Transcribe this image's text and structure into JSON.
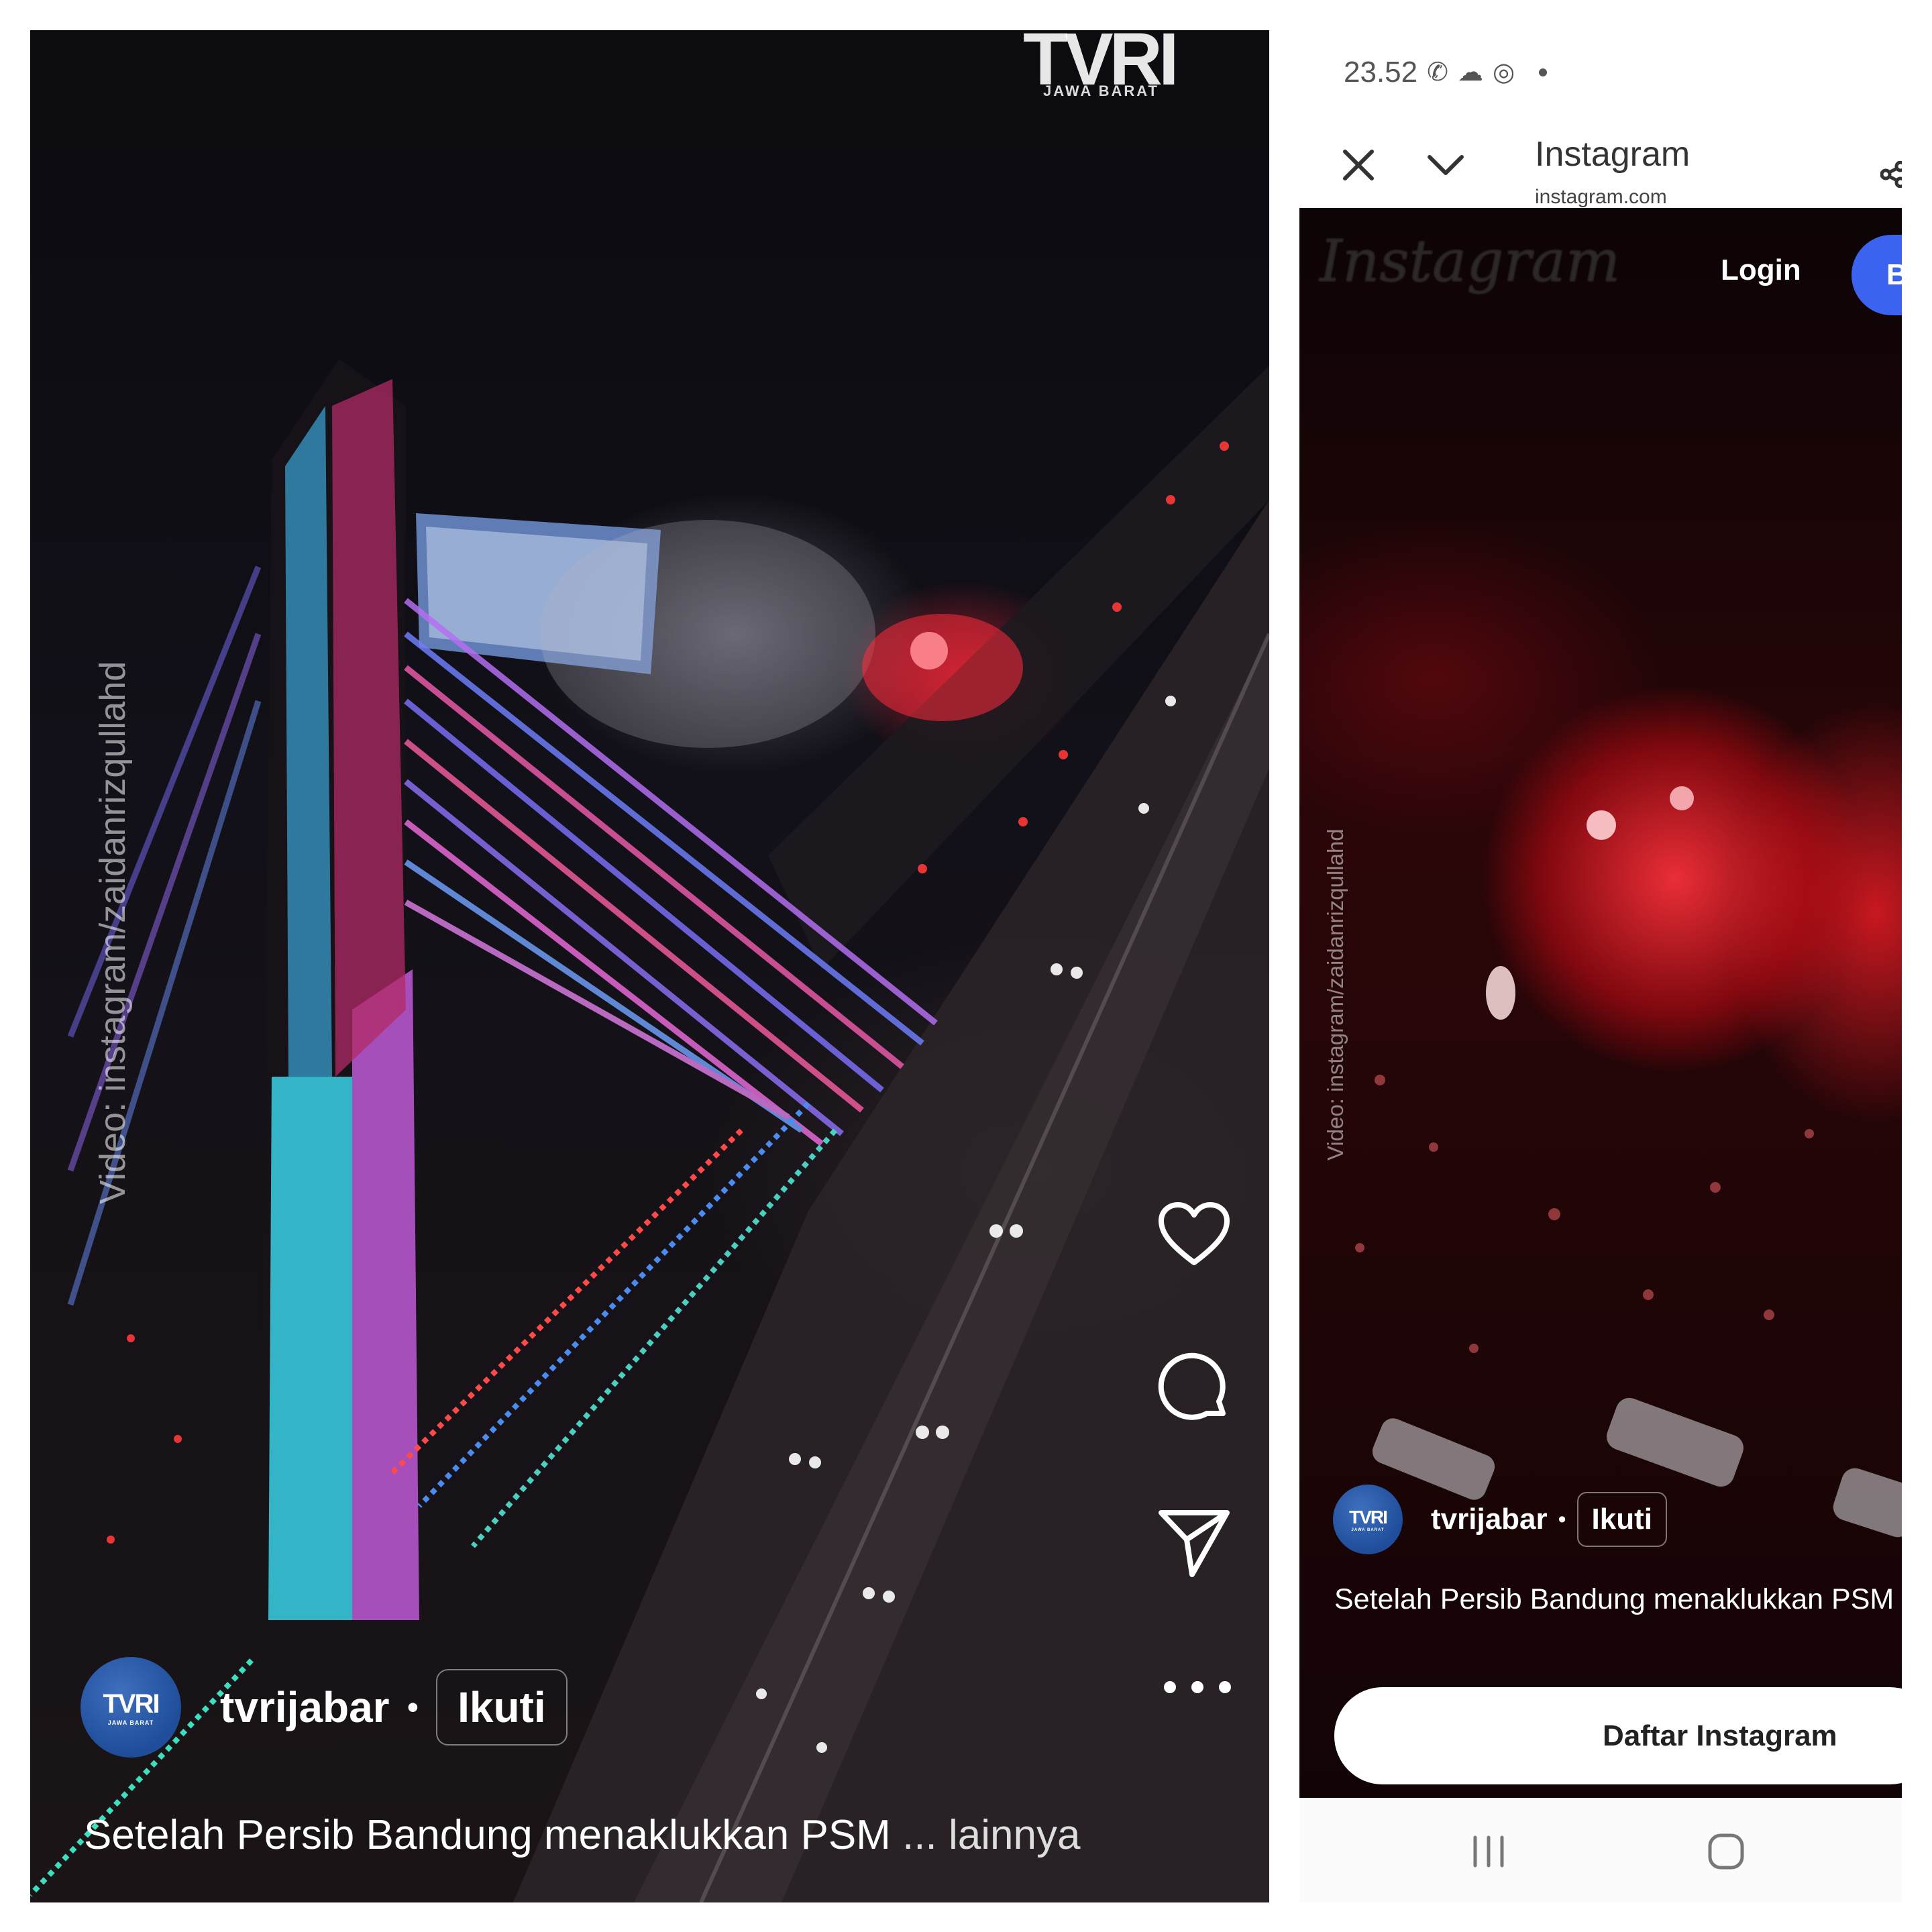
{
  "left": {
    "watermark_text": "Video: instagram/zaidanrizqullahd",
    "channel_logo": "TVRI",
    "channel_logo_sub": "JAWA BARAT",
    "author": "tvrijabar",
    "avatar_text": "TVRI",
    "separator": "•",
    "follow_label": "Ikuti",
    "caption": "Setelah Persib Bandung menaklukkan PSM",
    "caption_more": "... lainnya",
    "icons": [
      "heart-icon",
      "comment-icon",
      "share-icon",
      "more-icon"
    ]
  },
  "right": {
    "status": {
      "time": "23.52",
      "icons": [
        "whatsapp-icon",
        "cloud-icon",
        "camera-icon"
      ]
    },
    "browser": {
      "title": "Instagram",
      "url": "instagram.com"
    },
    "header": {
      "logo": "Instagram",
      "login_label": "Login",
      "signup_label": "B"
    },
    "watermark_text": "Video: instagram/zaidanrizqullahd",
    "author": "tvrijabar",
    "avatar_text": "TVRI",
    "separator": "•",
    "follow_label": "Ikuti",
    "caption": "Setelah Persib Bandung menaklukkan PSM",
    "cta_label": "Daftar Instagram"
  },
  "colors": {
    "signup_blue": "#3b63f0",
    "avatar_blue": "#2a5aab",
    "flare_red": "#ff2a3a"
  }
}
